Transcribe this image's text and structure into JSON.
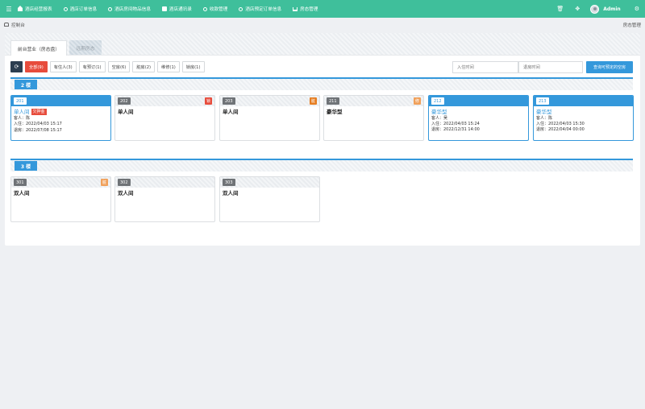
{
  "topbar": {
    "menu_icon": "menu-icon",
    "nav": [
      {
        "label": "酒店经营报表",
        "icon": "home-icon"
      },
      {
        "label": "酒店订单信息",
        "icon": "circle-icon"
      },
      {
        "label": "酒店房间物品信息",
        "icon": "circle-icon"
      },
      {
        "label": "酒店通讯录",
        "icon": "card-icon"
      },
      {
        "label": "收款管理",
        "icon": "circle-icon"
      },
      {
        "label": "酒店预定订单信息",
        "icon": "circle-icon"
      },
      {
        "label": "房态管理",
        "icon": "bed-icon"
      }
    ],
    "user": "Admin"
  },
  "breadcrumb": {
    "left": "控制台",
    "right": "房态管理"
  },
  "tabs": {
    "active": "前台营业（房态盘）",
    "inactive": "远期房态"
  },
  "filters": [
    {
      "label": "全部(9)",
      "key": "all"
    },
    {
      "label": "有住人(3)",
      "key": "occupied"
    },
    {
      "label": "有预订(1)",
      "key": "booked"
    },
    {
      "label": "空房(6)",
      "key": "vacant"
    },
    {
      "label": "脏房(2)",
      "key": "dirty"
    },
    {
      "label": "维修(1)",
      "key": "repair"
    },
    {
      "label": "锁房(1)",
      "key": "locked"
    }
  ],
  "search": {
    "in_placeholder": "入住时间",
    "out_placeholder": "退房时间",
    "button": "查询可预定的空房"
  },
  "floors": [
    {
      "label": "2 楼",
      "rooms": [
        {
          "num": "201",
          "type": "单人间",
          "occupied": true,
          "badge": "欠押金",
          "guest": "客人：陈",
          "checkin": "入住：2022/04/03 15:17",
          "checkout": "退房：2022/07/08 15:17"
        },
        {
          "num": "202",
          "type": "单人间",
          "occupied": false,
          "tag": "锁",
          "tag_color": "#e74c3c"
        },
        {
          "num": "203",
          "type": "单人间",
          "occupied": false,
          "tag": "脏",
          "tag_color": "#e67e22"
        },
        {
          "num": "211",
          "type": "豪华型",
          "occupied": false,
          "tag": "修",
          "tag_color": "#f0a05a"
        },
        {
          "num": "212",
          "type": "豪华型",
          "occupied": true,
          "guest": "客人：吴",
          "checkin": "入住：2022/04/03 15:24",
          "checkout": "退房：2022/12/31 14:00"
        },
        {
          "num": "213",
          "type": "豪华型",
          "occupied": true,
          "guest": "客人：陈",
          "checkin": "入住：2022/04/03 15:30",
          "checkout": "退房：2022/04/04 00:00"
        }
      ]
    },
    {
      "label": "3 楼",
      "rooms": [
        {
          "num": "301",
          "type": "双人间",
          "occupied": false,
          "tag": "脏",
          "tag_color": "#f0a05a"
        },
        {
          "num": "302",
          "type": "双人间",
          "occupied": false
        },
        {
          "num": "303",
          "type": "双人间",
          "occupied": false
        }
      ]
    }
  ]
}
